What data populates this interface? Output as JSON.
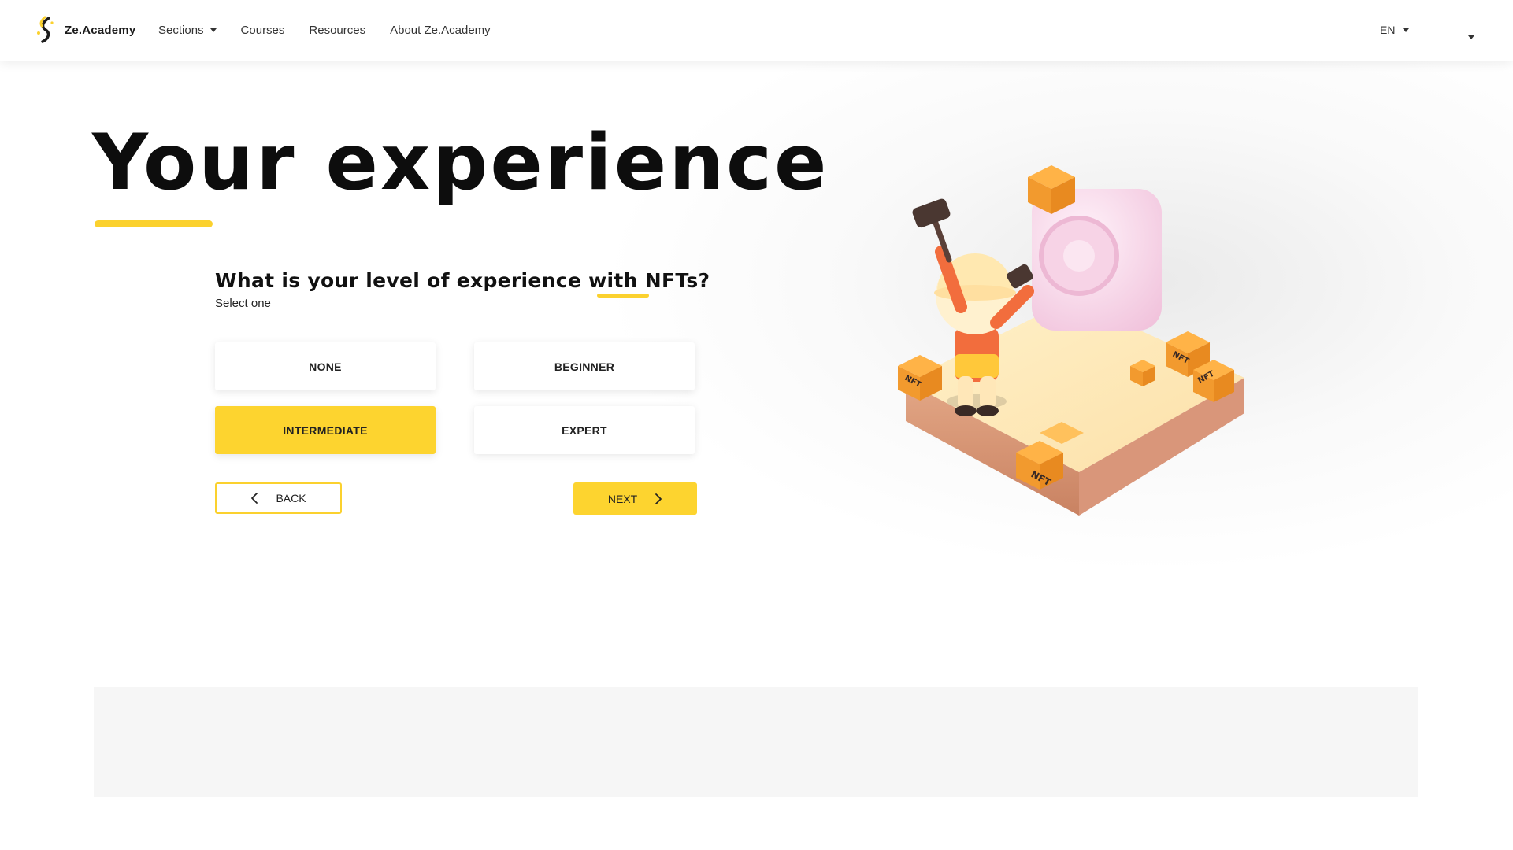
{
  "brand": {
    "name": "Ze.Academy",
    "accent": "#FDD42F"
  },
  "nav": {
    "items": [
      {
        "label": "Sections",
        "has_dropdown": true
      },
      {
        "label": "Courses",
        "has_dropdown": false
      },
      {
        "label": "Resources",
        "has_dropdown": false
      },
      {
        "label": "About Ze.Academy",
        "has_dropdown": false
      }
    ],
    "language": "EN"
  },
  "page": {
    "title": "Your experience",
    "question": "What is your level of experience with NFTs?",
    "hint": "Select one"
  },
  "options": [
    {
      "label": "NONE",
      "selected": false
    },
    {
      "label": "BEGINNER",
      "selected": false
    },
    {
      "label": "INTERMEDIATE",
      "selected": true
    },
    {
      "label": "EXPERT",
      "selected": false
    }
  ],
  "actions": {
    "back": "BACK",
    "next": "NEXT"
  },
  "illustration": {
    "icon": "nft-miner-illustration",
    "crate_label": "NFT"
  }
}
